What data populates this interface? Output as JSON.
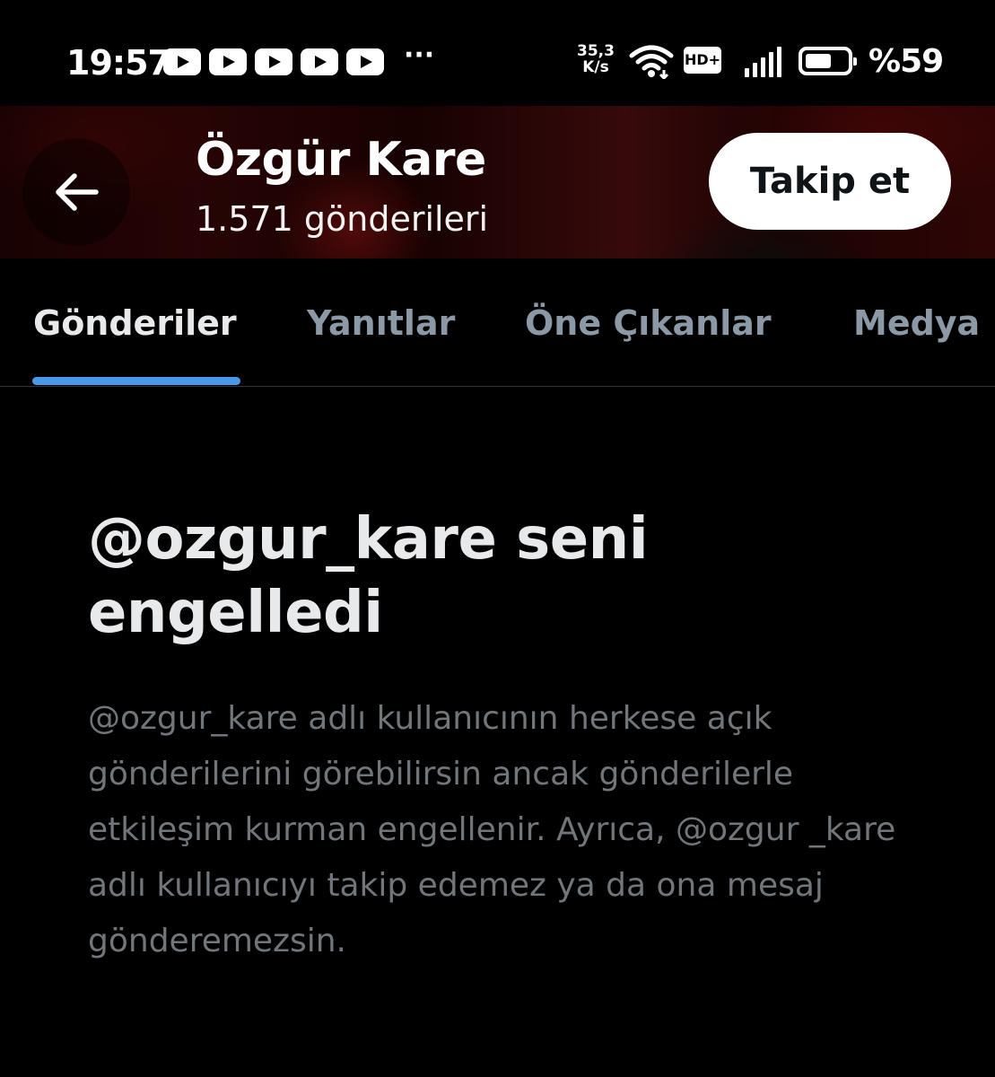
{
  "status_bar": {
    "time": "19:57",
    "notification_icons": [
      "youtube-icon",
      "youtube-icon",
      "youtube-icon",
      "youtube-icon",
      "youtube-icon"
    ],
    "more": "···",
    "net_speed_value": "35,3",
    "net_speed_unit": "K/s",
    "hd_label": "HD+",
    "battery_percent": "%59",
    "battery_level": 0.59
  },
  "header": {
    "name": "Özgür Kare",
    "post_count": "1.571 gönderileri",
    "follow_label": "Takip et"
  },
  "tabs": [
    {
      "label": "Gönderiler",
      "active": true
    },
    {
      "label": "Yanıtlar",
      "active": false
    },
    {
      "label": "Öne Çıkanlar",
      "active": false
    },
    {
      "label": "Medya",
      "active": false
    }
  ],
  "blocked": {
    "title": "@ozgur_kare seni engelledi",
    "description": "@ozgur_kare adlı kullanıcının herkese açık gönderilerini görebilirsin ancak gönderilerle etkileşim kurman engellenir. Ayrıca, @ozgur _kare adlı kullanıcıyı takip edemez ya da ona mesaj gönderemezsin."
  },
  "colors": {
    "background": "#000000",
    "tab_indicator": "#4a99e9",
    "primary_text": "#e7e9ea",
    "secondary_text": "#71767b",
    "inactive_tab": "#8b98a5"
  }
}
